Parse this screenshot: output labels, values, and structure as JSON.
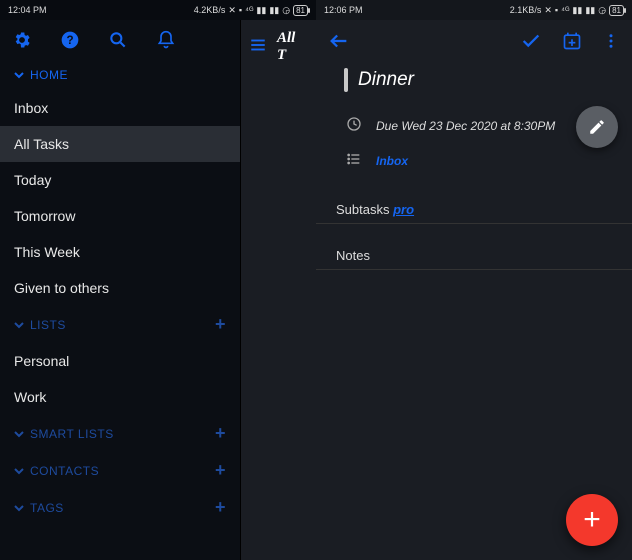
{
  "left": {
    "status": {
      "time": "12:04 PM",
      "net": "4.2KB/s",
      "battery": "81"
    },
    "secondary_title": "All T",
    "sections": {
      "home": {
        "label": "HOME",
        "items": [
          "Inbox",
          "All Tasks",
          "Today",
          "Tomorrow",
          "This Week",
          "Given to others"
        ],
        "selected_index": 1
      },
      "lists": {
        "label": "LISTS",
        "items": [
          "Personal",
          "Work"
        ]
      },
      "smart_lists": {
        "label": "SMART LISTS"
      },
      "contacts": {
        "label": "CONTACTS"
      },
      "tags": {
        "label": "TAGS"
      }
    }
  },
  "right": {
    "status": {
      "time": "12:06 PM",
      "net": "2.1KB/s",
      "battery": "81"
    },
    "task": {
      "title": "Dinner",
      "due": "Due Wed 23 Dec 2020 at 8:30PM",
      "list": "Inbox"
    },
    "subtasks_label": "Subtasks",
    "subtasks_pro": "pro",
    "notes_label": "Notes"
  }
}
